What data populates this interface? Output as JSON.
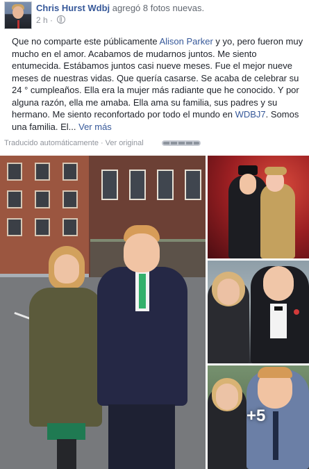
{
  "post": {
    "author": "Chris Hurst Wdbj",
    "action": "agregó 8 fotos nuevas.",
    "time": "2 h",
    "privacy_icon": "globe-icon",
    "text_before_link1": "Que no comparte este públicamente ",
    "link1": "Alison Parker",
    "text_after_link1": " y yo, pero fueron muy mucho en el amor. Acabamos de mudarnos juntos. Me siento entumecida. Estábamos juntos casi nueve meses. Fue el mejor nueve meses de nuestras vidas. Que quería casarse. Se acaba de celebrar su 24 ° cumpleaños. Ella era la mujer más radiante que he conocido. Y por alguna razón, ella me amaba. Ella ama su familia, sus padres y su hermano. Me siento reconfortado por todo el mundo en ",
    "link2": "WDBJ7",
    "text_after_link2": ". Somos una familia. El...",
    "see_more": "Ver más"
  },
  "translation": {
    "auto_label": "Traducido automáticamente",
    "separator": "·",
    "original_link": "Ver original"
  },
  "photos": {
    "more_count": "+5"
  },
  "colors": {
    "link": "#365899",
    "meta": "#90949c",
    "text": "#1d2129"
  }
}
